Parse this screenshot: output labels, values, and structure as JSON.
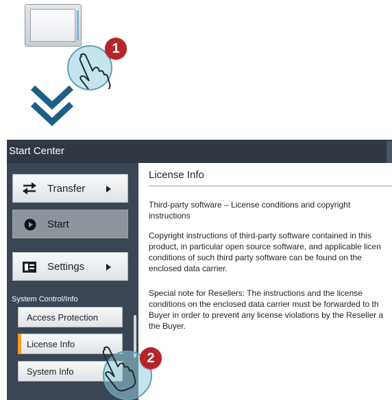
{
  "window": {
    "title": "Start Center"
  },
  "steps": {
    "first": "1",
    "second": "2"
  },
  "sidebar": {
    "buttons": [
      {
        "label": "Transfer",
        "icon": "transfer-arrows-icon"
      },
      {
        "label": "Start",
        "icon": "play-icon"
      },
      {
        "label": "Settings",
        "icon": "settings-panel-icon"
      }
    ],
    "section_label": "System Control/Info",
    "items": [
      {
        "label": "Access Protection"
      },
      {
        "label": "License Info"
      },
      {
        "label": "System Info"
      }
    ]
  },
  "content": {
    "heading": "License Info",
    "subtitle": "Third-party software – License conditions and copyright instructions",
    "paragraph1": "Copyright instructions of third-party software contained  in this\nproduct, in particular open source software, and applicable licen\nconditions of such third party software can be found on the\nenclosed data carrier.",
    "paragraph2": "Special note for Resellers: The instructions and the license\nconditions on the enclosed data carrier must be forwarded to th\nBuyer in order to prevent any license violations by the Reseller a\nthe Buyer."
  },
  "colors": {
    "titlebar": "#2f3843",
    "sidebar": "#3a4653",
    "selected_accent": "#f29c1d",
    "arrow": "#1e5f86",
    "step_badge": "#b8232a"
  }
}
